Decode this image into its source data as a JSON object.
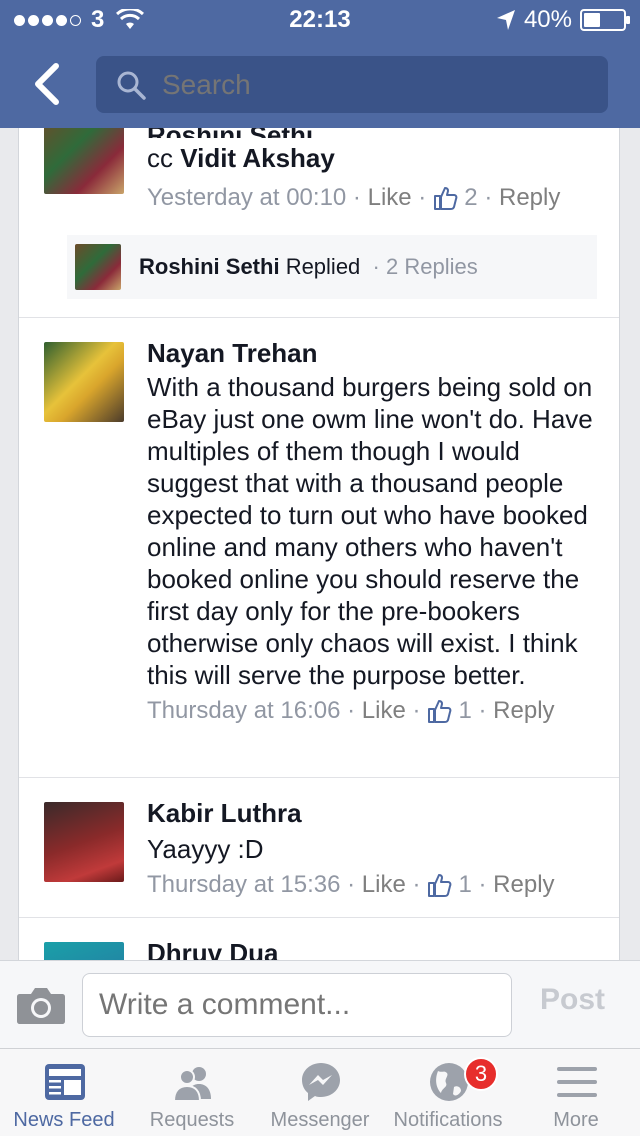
{
  "status_bar": {
    "carrier": "3",
    "time": "22:13",
    "battery": "40%"
  },
  "nav": {
    "search_placeholder": "Search"
  },
  "comments": [
    {
      "name_partial": "Roshini Sethi",
      "text_prefix": "cc ",
      "tagged": "Vidit Akshay",
      "time": "Yesterday at 00:10",
      "like_label": "Like",
      "likes": "2",
      "reply_label": "Reply",
      "reply_preview": {
        "name": "Roshini Sethi",
        "action": "Replied",
        "count": "2 Replies"
      }
    },
    {
      "name": "Nayan Trehan",
      "text": "With a thousand burgers being sold on eBay just one owm line won't do. Have multiples of them though I would suggest that with a thousand people expected to turn out who have booked online and many others who haven't booked online you should reserve the first day only for the pre-bookers otherwise only chaos will exist. I think this will serve the purpose better.",
      "time": "Thursday at 16:06",
      "like_label": "Like",
      "likes": "1",
      "reply_label": "Reply"
    },
    {
      "name": "Kabir Luthra",
      "text": "Yaayyy :D",
      "time": "Thursday at 15:36",
      "like_label": "Like",
      "likes": "1",
      "reply_label": "Reply"
    },
    {
      "name": "Dhruv Dua"
    }
  ],
  "composer": {
    "placeholder": "Write a comment...",
    "post_label": "Post"
  },
  "tabs": [
    {
      "label": "News Feed",
      "icon": "news-feed-icon",
      "active": true
    },
    {
      "label": "Requests",
      "icon": "requests-icon"
    },
    {
      "label": "Messenger",
      "icon": "messenger-icon"
    },
    {
      "label": "Notifications",
      "icon": "globe-icon",
      "badge": "3"
    },
    {
      "label": "More",
      "icon": "menu-icon"
    }
  ],
  "colors": {
    "brand": "#4e69a2",
    "badge": "#e72e2c",
    "meta_text": "#9197a3"
  }
}
